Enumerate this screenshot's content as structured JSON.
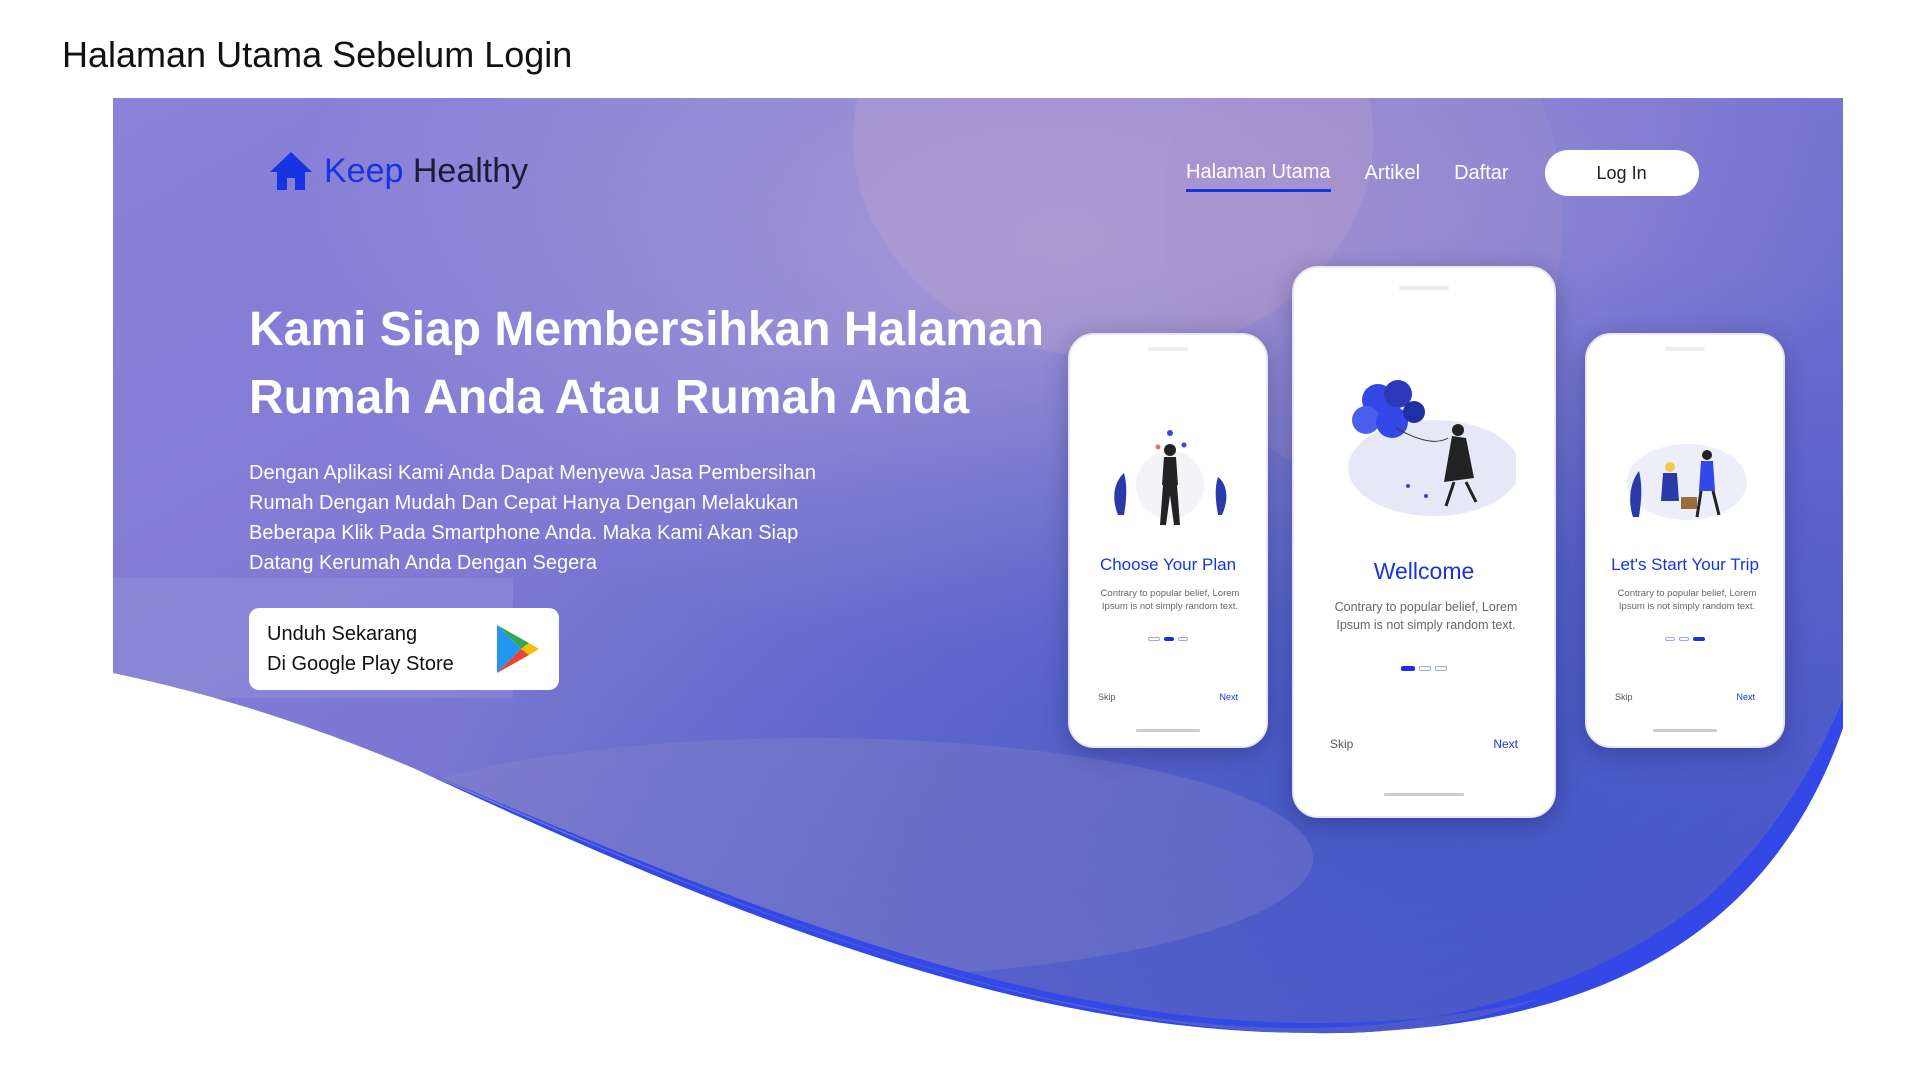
{
  "page_caption": "Halaman Utama Sebelum Login",
  "header": {
    "logo": {
      "icon": "home-icon",
      "word1": "Keep",
      "word2": "Healthy"
    },
    "nav": [
      {
        "label": "Halaman Utama",
        "active": true
      },
      {
        "label": "Artikel",
        "active": false
      },
      {
        "label": "Daftar",
        "active": false
      }
    ],
    "login_label": "Log In"
  },
  "hero": {
    "headline_line1": "Kami Siap Membersihkan Halaman",
    "headline_line2": "Rumah Anda Atau Rumah Anda",
    "description_lines": [
      "Dengan Aplikasi Kami Anda Dapat Menyewa Jasa Pembersihan",
      "Rumah Dengan Mudah Dan Cepat Hanya Dengan Melakukan",
      "Beberapa Klik Pada Smartphone Anda. Maka Kami Akan Siap",
      "Datang Kerumah Anda Dengan Segera"
    ],
    "store_button": {
      "line1": "Unduh Sekarang",
      "line2": "Di Google Play Store",
      "icon": "google-play-icon"
    }
  },
  "phones": [
    {
      "title": "Choose Your Plan",
      "body_line1": "Contrary to popular belief, Lorem",
      "body_line2": "Ipsum is not simply random text.",
      "skip": "Skip",
      "next": "Next",
      "active_dot": 1
    },
    {
      "title": "Wellcome",
      "body_line1": "Contrary to popular belief, Lorem",
      "body_line2": "Ipsum is not simply random text.",
      "skip": "Skip",
      "next": "Next",
      "active_dot": 0
    },
    {
      "title": "Let's Start Your Trip",
      "body_line1": "Contrary to popular belief, Lorem",
      "body_line2": "Ipsum is not simply random text.",
      "skip": "Skip",
      "next": "Next",
      "active_dot": 2
    }
  ],
  "colors": {
    "accent": "#1a33e0",
    "wave": "#3348e6",
    "overlay": "#6a6ad6"
  }
}
